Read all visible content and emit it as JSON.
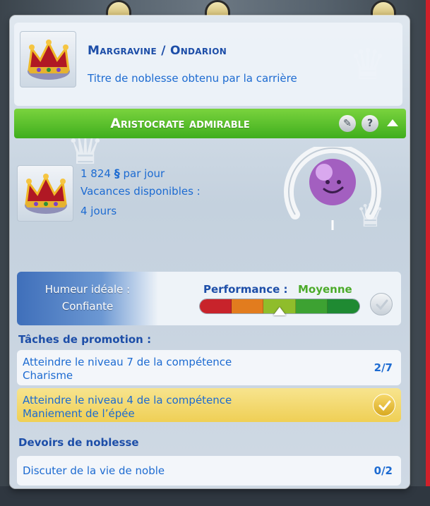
{
  "title_card": {
    "name": "Margravine / Ondarion",
    "description": "Titre de noblesse obtenu par la carrière"
  },
  "career": {
    "title": "Aristocrate admirable"
  },
  "pay": {
    "amount": "1 824",
    "currency_symbol": "§",
    "per_day": "par jour",
    "vacation_label": "Vacances disponibles :",
    "vacation_value": "4 jours"
  },
  "performance": {
    "mood_label": "Humeur idéale :",
    "mood_value": "Confiante",
    "label": "Performance :",
    "value": "Moyenne",
    "level": 0.5
  },
  "promotion": {
    "title": "Tâches de promotion :",
    "tasks": [
      {
        "label_line1": "Atteindre le niveau 7 de la compétence",
        "label_line2": "Charisme",
        "count": "2/7",
        "done": false
      },
      {
        "label_line1": "Atteindre le niveau 4 de la compétence",
        "label_line2": "Maniement de l’épée",
        "count": "",
        "done": true
      }
    ]
  },
  "duties": {
    "title": "Devoirs de noblesse",
    "tasks": [
      {
        "label": "Discuter de la vie de noble",
        "count": "0/2"
      }
    ]
  },
  "colors": {
    "career_bar": "#52be2a",
    "accent_blue": "#1d6bd1",
    "perf_green": "#4cab2a",
    "done_task": "#efcf55"
  }
}
